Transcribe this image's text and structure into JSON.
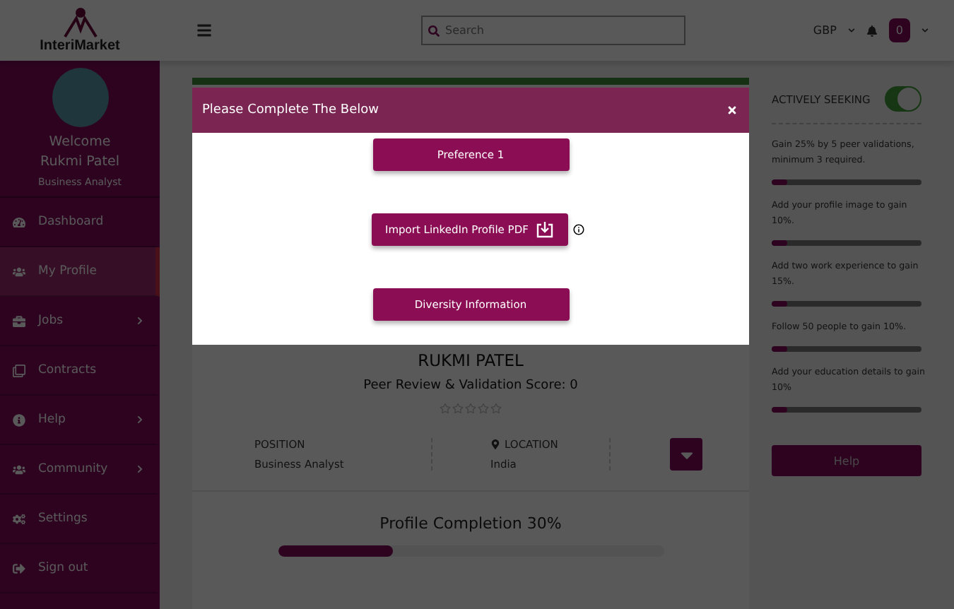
{
  "brand": {
    "name": "InteriMarket"
  },
  "header": {
    "search": {
      "placeholder": "Search"
    },
    "currency": "GBP",
    "notifications": "0"
  },
  "sidebar": {
    "welcome": "Welcome",
    "user": "Rukmi Patel",
    "role": "Business Analyst",
    "items": [
      {
        "label": "Dashboard",
        "selected": false,
        "submenu": false
      },
      {
        "label": "My Profile",
        "selected": true,
        "submenu": false
      },
      {
        "label": "Jobs",
        "selected": false,
        "submenu": true
      },
      {
        "label": "Contracts",
        "selected": false,
        "submenu": false
      },
      {
        "label": "Help",
        "selected": false,
        "submenu": true
      },
      {
        "label": "Community",
        "selected": false,
        "submenu": true
      },
      {
        "label": "Settings",
        "selected": false,
        "submenu": false
      },
      {
        "label": "Sign out",
        "selected": false,
        "submenu": false
      }
    ]
  },
  "profile": {
    "name": "RUKMI PATEL",
    "score": "Peer Review & Validation Score: 0",
    "stars": 0,
    "fields": [
      {
        "label": "POSITION",
        "value": "Business Analyst",
        "kind": "plain"
      },
      {
        "label": "LOCATION",
        "value": "India",
        "kind": "location"
      }
    ],
    "completion": {
      "label": "Profile Completion 30%",
      "level": 0.3
    }
  },
  "right": {
    "seeking": {
      "label": "ACTIVELY SEEKING",
      "on": true
    },
    "tasks": [
      {
        "text": "Gain 25% by 5 peer validations, minimum 3 required.",
        "level": 0.1
      },
      {
        "text": "Add your profile image to gain 10%.",
        "level": 0.1
      },
      {
        "text": "Add two work experience to gain 15%.",
        "level": 0.1
      },
      {
        "text": "Follow 50 people to gain 10%.",
        "level": 0.1
      },
      {
        "text": "Add your education details to gain 10%",
        "level": 0.1
      }
    ],
    "help": "Help"
  },
  "modal": {
    "title": "Please Complete The Below",
    "buttons": [
      {
        "label": "Preference 1",
        "kind": "plain"
      },
      {
        "label": "Import LinkedIn Profile PDF",
        "kind": "import"
      },
      {
        "label": "Diversity Information",
        "kind": "plain"
      }
    ]
  }
}
